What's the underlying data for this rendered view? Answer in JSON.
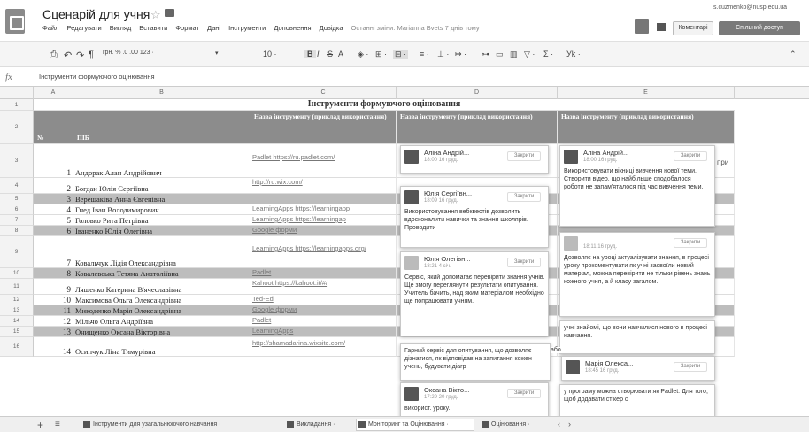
{
  "doc": {
    "title": "Сценарій для учня",
    "menu": [
      "Файл",
      "Редагувати",
      "Вигляд",
      "Вставити",
      "Формат",
      "Дані",
      "Інструменти",
      "Доповнення",
      "Довідка"
    ],
    "last_edit": "Останні зміни: Marianna Bvets 7 днів тому",
    "user_email": "s.cuzmenko@nusp.edu.ua",
    "comments_label": "Коментарі",
    "share_label": "Спільний доступ"
  },
  "toolbar": {
    "zoom": "грн. % .0 .00 123 ·",
    "font_size": "10 ·",
    "bold": "B",
    "italic": "I",
    "strike": "S",
    "underline_a": "A",
    "sigma": "Σ ·",
    "lang": "Уk ·"
  },
  "formula_bar": {
    "fx": "fx",
    "text": "Інструменти формуючого оцінювання"
  },
  "columns": [
    "A",
    "B",
    "C",
    "D",
    "E"
  ],
  "sheet": {
    "title_row": "Інструменти формуючого оцінювання",
    "header": {
      "no": "№",
      "pib": "ПІБ",
      "tool_c": "Назва інструменту (приклад використання)",
      "tool_d": "Назва інструменту (приклад використання)",
      "tool_e": "Назва інструменту (приклад використання)"
    },
    "rows": [
      {
        "rn": "3",
        "no": "1",
        "name": "Андорак Алан Андрійович",
        "link": "Padlet https://ru.padlet.com/"
      },
      {
        "rn": "4",
        "no": "2",
        "name": "Богдан Юлія Сергіївна",
        "link": "http://ru.wix.com/"
      },
      {
        "rn": "5",
        "no": "3",
        "name": "Верещаківа Анна Євгенівна",
        "link": ""
      },
      {
        "rn": "6",
        "no": "4",
        "name": "Гнед Іван Володимирович",
        "link": "LearningApps https://learningapp"
      },
      {
        "rn": "7",
        "no": "5",
        "name": "Головко Рита Петрівна",
        "link": "LearningApps https://learningap"
      },
      {
        "rn": "8",
        "no": "6",
        "name": "Іваненко Юлія Олегівна",
        "link": "Google форми"
      },
      {
        "rn": "9",
        "no": "7",
        "name": "Ковальчук Лідія Олександрівна",
        "link": "LearningApps https://learningapps.org/"
      },
      {
        "rn": "10",
        "no": "8",
        "name": "Ковалевська Тетяна Анатоліївна",
        "link": "Padlet"
      },
      {
        "rn": "11",
        "no": "9",
        "name": "Лященко Катерина В'ячеславівна",
        "link": "Kahoot https://kahoot.it/#/"
      },
      {
        "rn": "12",
        "no": "10",
        "name": "Максимова Ольга Олександрівна",
        "link": "Ted-Ed"
      },
      {
        "rn": "13",
        "no": "11",
        "name": "Микоденко Марія Олександрівна",
        "link": "Google форми"
      },
      {
        "rn": "14",
        "no": "12",
        "name": "Мільчо Ольга Андріївна",
        "link": "Padlet"
      },
      {
        "rn": "15",
        "no": "13",
        "name": "Онищенко Оксана Вікторівна",
        "link": "LearningApps"
      },
      {
        "rn": "16",
        "no": "14",
        "name": "Осипчук Ліна Тимурівна",
        "link": "http://shamadarina.wixsite.com/"
      }
    ],
    "e_fragment": "при"
  },
  "comments_d": [
    {
      "name": "Аліна Андрій...",
      "time": "18:00 16 груд.",
      "btn": "Закрити",
      "text": "",
      "dark": true
    },
    {
      "name": "Юлія Сергіївн...",
      "time": "18:09 16 груд.",
      "btn": "Закрити",
      "text": "Використовування вебквестів дозволить вдосконалити навички та знання школярів. Проводити",
      "dark": true
    },
    {
      "name": "Юлія Олегівн...",
      "time": "18:21 4 січ.",
      "btn": "Закрити",
      "text": "Сервіс, який допомагає перевірити знання учнів. Ще змогу переглянути результати опитування. Учитель бачить, над яким матеріалом необхідно ще попрацювати учням.",
      "dark": false
    },
    {
      "name": "",
      "time": "",
      "btn": "",
      "text": "Гарний сервіс для опитування, що дозволяє дізнатися, як відповідав на запитання кожен учень, будувати діагр",
      "dark": false
    },
    {
      "name": "Оксана Вікто...",
      "time": "17:29 20 груд.",
      "btn": "Закрити",
      "text": "використ. уроку.",
      "dark": true
    }
  ],
  "comments_e": [
    {
      "name": "Аліна Андрій...",
      "time": "18:00 16 груд.",
      "btn": "Закрити",
      "text": "Використовувати вікниці вивчення нової теми. Створити відео, що найбільше сподобалося роботи не запам'яталося під час вивчення теми.",
      "dark": true
    },
    {
      "name": "",
      "time": "18:11 16 груд.",
      "btn": "Закрити",
      "text": "Дозволяє на уроці актуалізувати знання, в процесі уроку прокоментувати як учні засвоїли новий матеріал, можна перевірити не тільки рівень знань кожного учня, а й класу загалом.",
      "dark": false
    },
    {
      "name": "",
      "time": "",
      "btn": "",
      "text": "учні знайомі, що вони навчилися нового в процесі навчання.",
      "dark": false
    },
    {
      "name": "Марія Олекса...",
      "time": "18:45 16 груд.",
      "btn": "Закрити",
      "text": "",
      "dark": true
    },
    {
      "name": "",
      "time": "",
      "btn": "",
      "text": "у програму можна створювати як Padlet. Для того, щоб додавати стікер с",
      "dark": false
    }
  ],
  "fragments": {
    "abo": "або",
    "diag": "діагр",
    "pic": "ще"
  },
  "tabs": [
    {
      "label": "Інструменти для узагальнюючого навчання ·",
      "active": false
    },
    {
      "label": "Викладання ·",
      "active": false
    },
    {
      "label": "Моніторинг та Оцінювання ·",
      "active": true
    },
    {
      "label": "Оцінювання ·",
      "active": false
    }
  ]
}
